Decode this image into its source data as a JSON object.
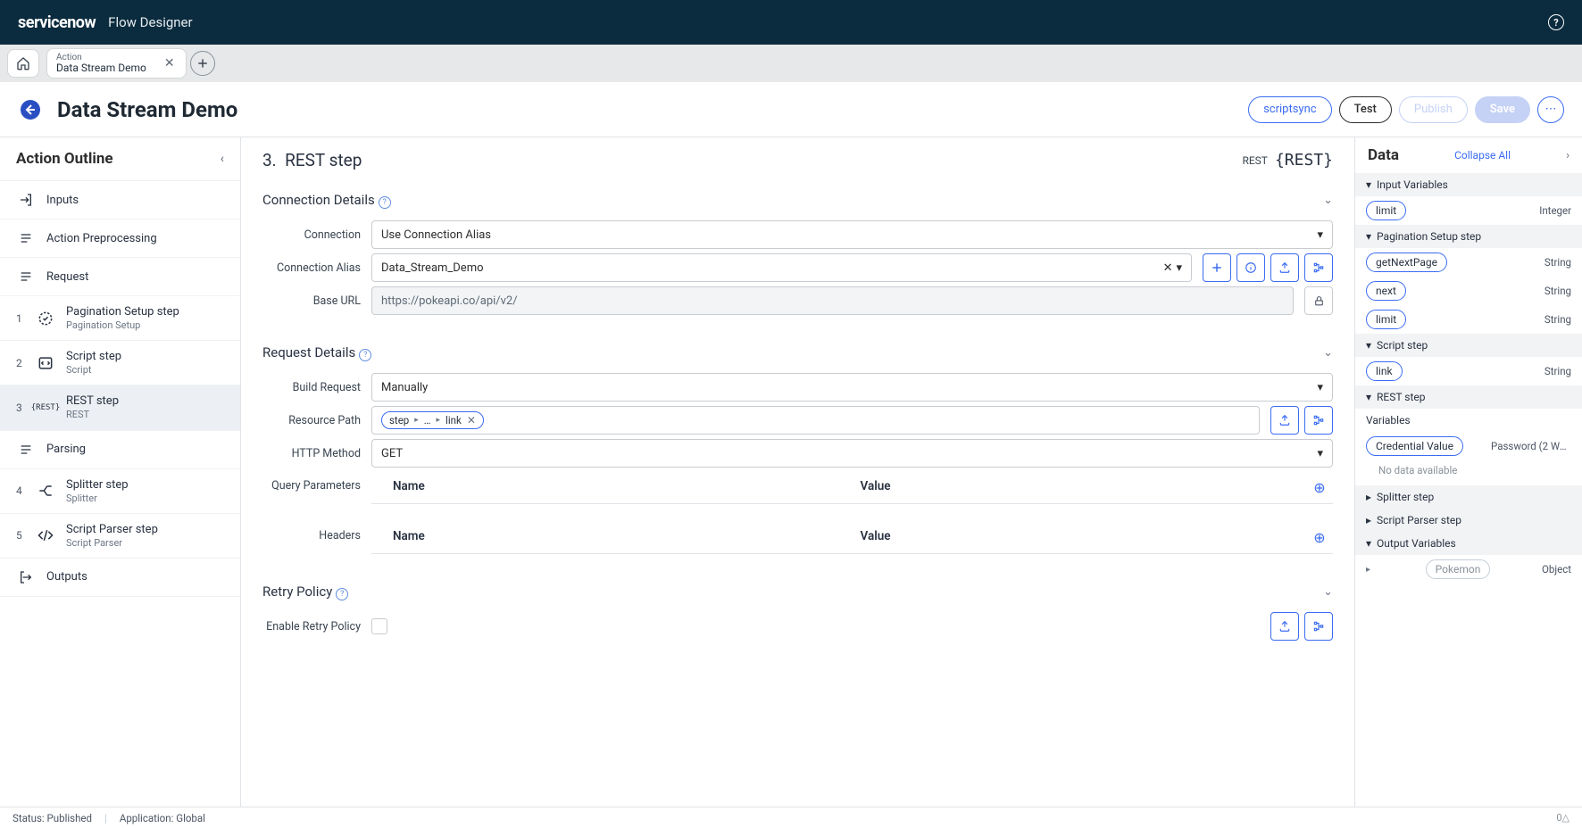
{
  "header": {
    "brand": "servicenow",
    "product": "Flow Designer"
  },
  "tab": {
    "type": "Action",
    "title": "Data Stream Demo"
  },
  "page": {
    "title": "Data Stream Demo",
    "buttons": {
      "scriptsync": "scriptsync",
      "test": "Test",
      "publish": "Publish",
      "save": "Save"
    }
  },
  "outline": {
    "title": "Action Outline",
    "items": {
      "inputs": "Inputs",
      "preprocess": "Action Preprocessing",
      "request": "Request",
      "step1": {
        "title": "Pagination Setup step",
        "sub": "Pagination Setup"
      },
      "step2": {
        "title": "Script step",
        "sub": "Script"
      },
      "step3": {
        "title": "REST step",
        "sub": "REST"
      },
      "parsing": "Parsing",
      "step4": {
        "title": "Splitter step",
        "sub": "Splitter"
      },
      "step5": {
        "title": "Script Parser step",
        "sub": "Script Parser"
      },
      "outputs": "Outputs"
    }
  },
  "center": {
    "step_number": "3.",
    "step_title": "REST step",
    "step_tag": "REST",
    "sections": {
      "conn": {
        "title": "Connection Details",
        "fields": {
          "connection_label": "Connection",
          "connection_value": "Use Connection Alias",
          "alias_label": "Connection Alias",
          "alias_value": "Data_Stream_Demo",
          "baseurl_label": "Base URL",
          "baseurl_value": "https://pokeapi.co/api/v2/"
        }
      },
      "req": {
        "title": "Request Details",
        "fields": {
          "build_label": "Build Request",
          "build_value": "Manually",
          "path_label": "Resource Path",
          "path_pill1": "step",
          "path_pill2": "…",
          "path_pill3": "link",
          "method_label": "HTTP Method",
          "method_value": "GET",
          "qp_label": "Query Parameters",
          "headers_label": "Headers",
          "name_col": "Name",
          "value_col": "Value"
        }
      },
      "retry": {
        "title": "Retry Policy",
        "enable_label": "Enable Retry Policy"
      }
    }
  },
  "data": {
    "title": "Data",
    "collapse": "Collapse All",
    "groups": {
      "input": "Input Variables",
      "pagination": "Pagination Setup step",
      "script": "Script step",
      "rest": "REST step",
      "rest_sub": "Variables",
      "no_data": "No data available",
      "splitter": "Splitter step",
      "parser": "Script Parser step",
      "output": "Output Variables"
    },
    "vars": {
      "limit": {
        "name": "limit",
        "type": "Integer"
      },
      "getNextPage": {
        "name": "getNextPage",
        "type": "String"
      },
      "next": {
        "name": "next",
        "type": "String"
      },
      "limit2": {
        "name": "limit",
        "type": "String"
      },
      "link": {
        "name": "link",
        "type": "String"
      },
      "cred": {
        "name": "Credential Value",
        "type": "Password (2 Way…"
      },
      "pokemon": {
        "name": "Pokemon",
        "type": "Object"
      }
    }
  },
  "status": {
    "left1": "Status: Published",
    "left2": "Application: Global"
  }
}
